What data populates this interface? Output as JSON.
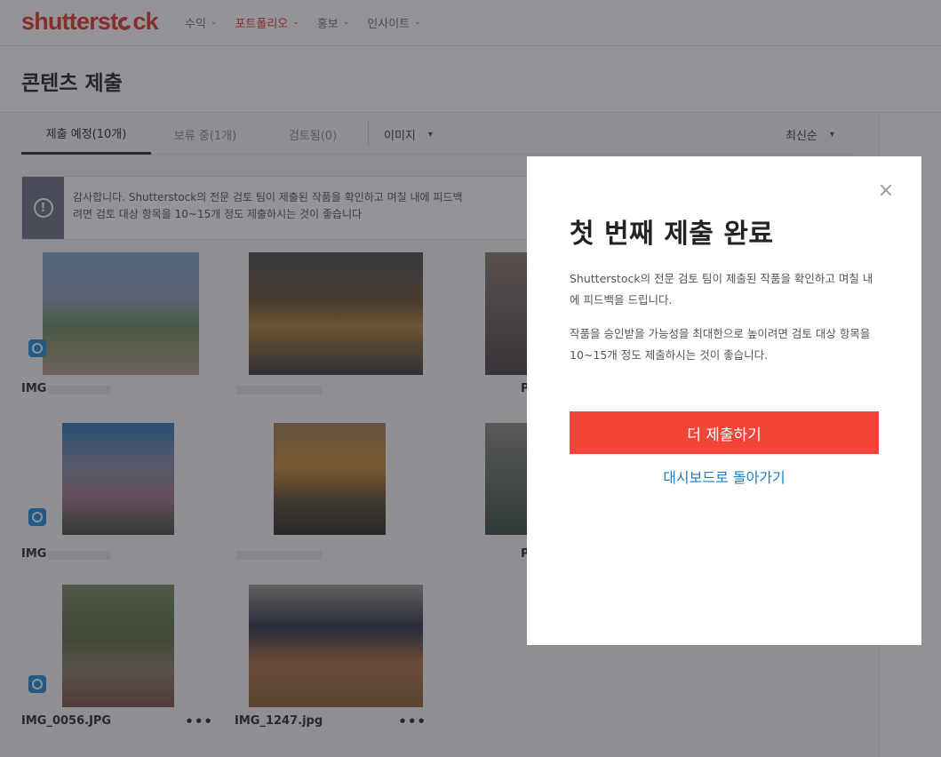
{
  "brand": {
    "logo_pre": "shutterst",
    "logo_post": "ck",
    "color": "#e0362b"
  },
  "nav": {
    "items": [
      {
        "label": "수익"
      },
      {
        "label": "포트폴리오"
      },
      {
        "label": "홍보"
      },
      {
        "label": "인사이트"
      }
    ],
    "chevron": "⌄"
  },
  "page": {
    "title": "콘텐츠 제출"
  },
  "tabs": [
    {
      "label": "제출 예정(10개)"
    },
    {
      "label": "보류 중(1개)"
    },
    {
      "label": "검토됨(0)"
    }
  ],
  "filters": {
    "type": "이미지",
    "sort": "최신순",
    "caret": "▾"
  },
  "notice": {
    "line1": "감사합니다. Shutterstock의 전문 검토 팀이 제출된 작품을 확인하고 며칠 내에 피드백",
    "line2": "려면 검토 대상 항목을 10~15개 정도 제출하시는 것이 좋습니다",
    "icon": "!"
  },
  "cards": [
    {
      "filename": "IMG_0056.JPG"
    },
    {
      "filename": "IMG_1247.jpg"
    }
  ],
  "partial_labels": {
    "a": "IMG",
    "b": "P"
  },
  "more_label": "•••",
  "modal": {
    "close": "×",
    "title": "첫 번째 제출 완료",
    "p1": "Shutterstock의 전문 검토 팀이 제출된 작품을 확인하고 며칠 내에 피드백을 드립니다.",
    "p2": "작품을 승인받을 가능성을 최대한으로 높이려면 검토 대상 항목을 10~15개 정도 제출하시는 것이 좋습니다.",
    "primary": "더 제출하기",
    "secondary": "대시보드로 돌아가기",
    "primary_color": "#f2453a",
    "link_color": "#1a7fbf"
  }
}
